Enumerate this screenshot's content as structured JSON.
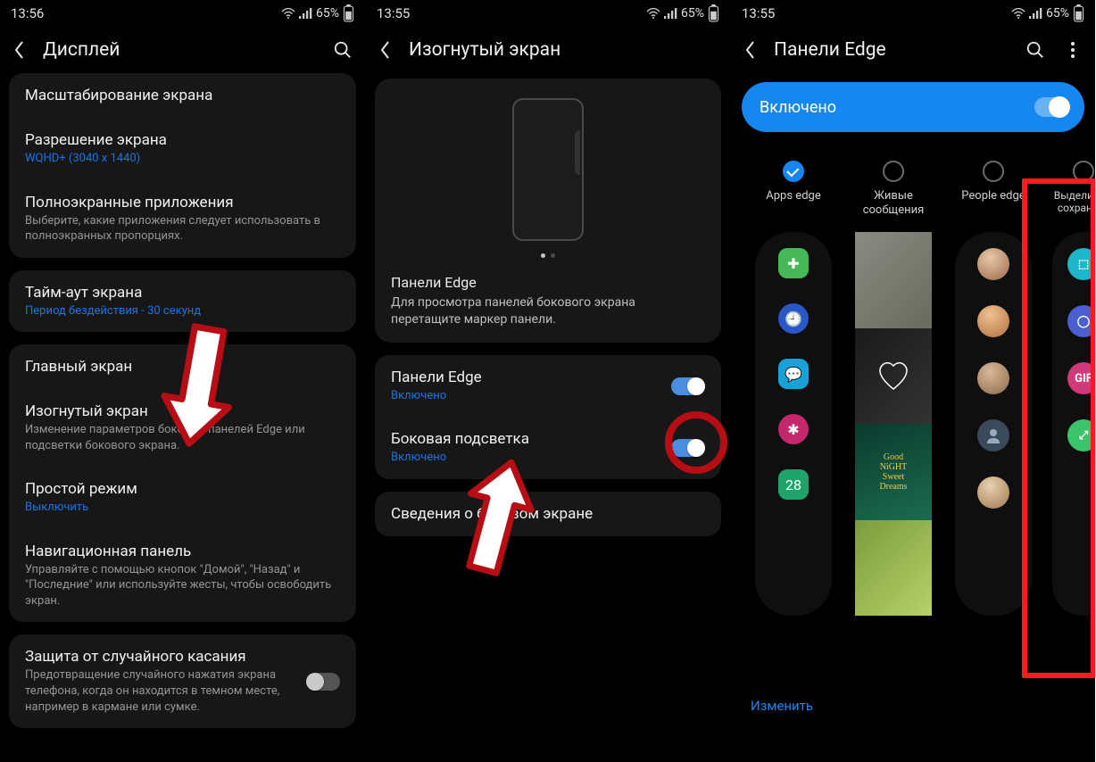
{
  "status": {
    "time1": "13:56",
    "time2": "13:55",
    "time3": "13:55",
    "battery": "65%"
  },
  "screen1": {
    "title": "Дисплей",
    "items": {
      "scale": "Масштабирование экрана",
      "resolution": "Разрешение экрана",
      "resolution_sub": "WQHD+ (3040 x 1440)",
      "fullscreen": "Полноэкранные приложения",
      "fullscreen_sub": "Выберите, какие приложения следует использовать в полноэкранных пропорциях.",
      "timeout": "Тайм-аут экрана",
      "timeout_sub": "Период бездействия - 30 секунд",
      "home": "Главный экран",
      "edge": "Изогнутый экран",
      "edge_sub": "Изменение параметров боковых панелей Edge или подсветки бокового экрана.",
      "simple": "Простой режим",
      "simple_sub": "Выключить",
      "nav": "Навигационная панель",
      "nav_sub": "Управляйте с помощью кнопок \"Домой\", \"Назад\" и \"Последние\" или используйте жесты, чтобы освободить экран.",
      "accidental": "Защита от случайного касания",
      "accidental_sub": "Предотвращение случайного нажатия экрана телефона, когда он находится в темном месте, например в кармане или сумке."
    }
  },
  "screen2": {
    "title": "Изогнутый экран",
    "preview_title": "Панели Edge",
    "preview_text": "Для просмотра панелей бокового экрана перетащите маркер панели.",
    "panels": "Панели Edge",
    "panels_sub": "Включено",
    "light": "Боковая подсветка",
    "light_sub": "Включено",
    "about": "Сведения о боковом экране"
  },
  "screen3": {
    "title": "Панели Edge",
    "enabled": "Включено",
    "edit": "Изменить",
    "cols": {
      "apps": "Apps edge",
      "live": "Живые сообщения",
      "people": "People edge",
      "select": "Выделить и сохранить"
    }
  }
}
